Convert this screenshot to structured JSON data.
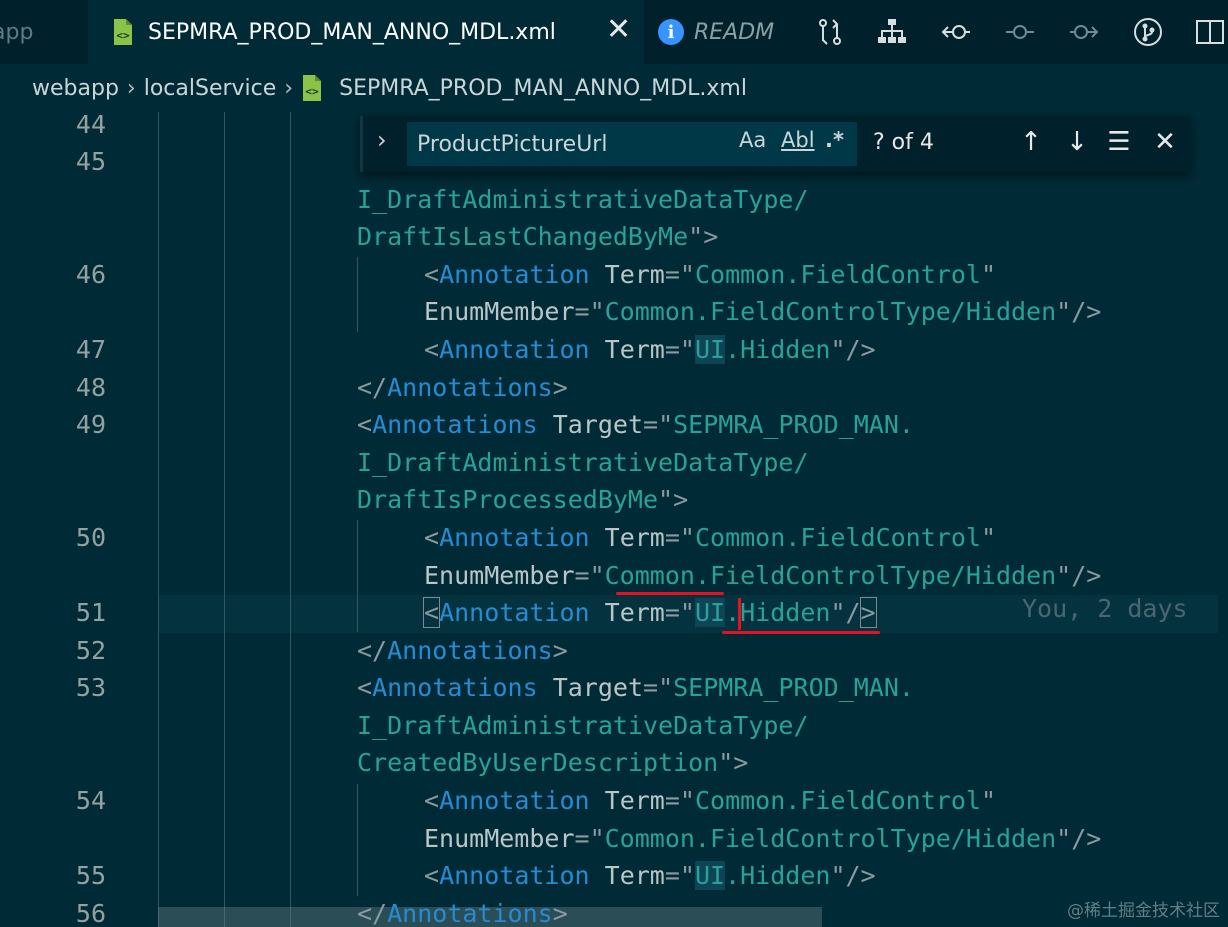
{
  "tabs": {
    "previous_label": "app",
    "active_label": "SEPMRA_PROD_MAN_ANNO_MDL.xml",
    "readme_label": "READM",
    "close_glyph": "✕"
  },
  "breadcrumb": {
    "items": [
      "webapp",
      "localService",
      "SEPMRA_PROD_MAN_ANNO_MDL.xml"
    ],
    "separator": "›"
  },
  "find": {
    "toggle_glyph": "›",
    "query": "ProductPictureUrl",
    "match_case_label": "Aa",
    "whole_word_label": "Abl",
    "regex_label": ".*",
    "count": "? of 4",
    "prev_glyph": "↑",
    "next_glyph": "↓",
    "selection_glyph": "☰",
    "close_glyph": "✕"
  },
  "gutter": [
    "44",
    "45",
    "46",
    "47",
    "48",
    "49",
    "50",
    "51",
    "52",
    "53",
    "54",
    "55",
    "56"
  ],
  "code": {
    "l45b": "I_DraftAdministrativeDataType/",
    "l45c": "DraftIsLastChangedByMe",
    "annotation_tag": "Annotation",
    "annotations_tag": "Annotations",
    "term_attr": "Term",
    "enum_attr": "EnumMember",
    "target_attr": "Target",
    "field_control": "Common.FieldControl",
    "field_control_hidden": "Common.FieldControlType/Hidden",
    "common": "Common",
    "field_control_hidden_rest": ".FieldControlType/Hidden",
    "ui": "UI",
    "hidden": ".Hidden",
    "target_prefix": "SEPMRA_PROD_MAN.",
    "target_mid": "I_DraftAdministrativeDataType/",
    "target_49_end": "DraftIsProcessedByMe",
    "target_53_end": "CreatedByUserDescription"
  },
  "blame": "You, 2 days",
  "watermark": "@稀土掘金技术社区",
  "colors": {
    "background": "#002b36",
    "tag": "#268bd2",
    "string": "#2aa198",
    "annotation_underline": "#e81123"
  }
}
